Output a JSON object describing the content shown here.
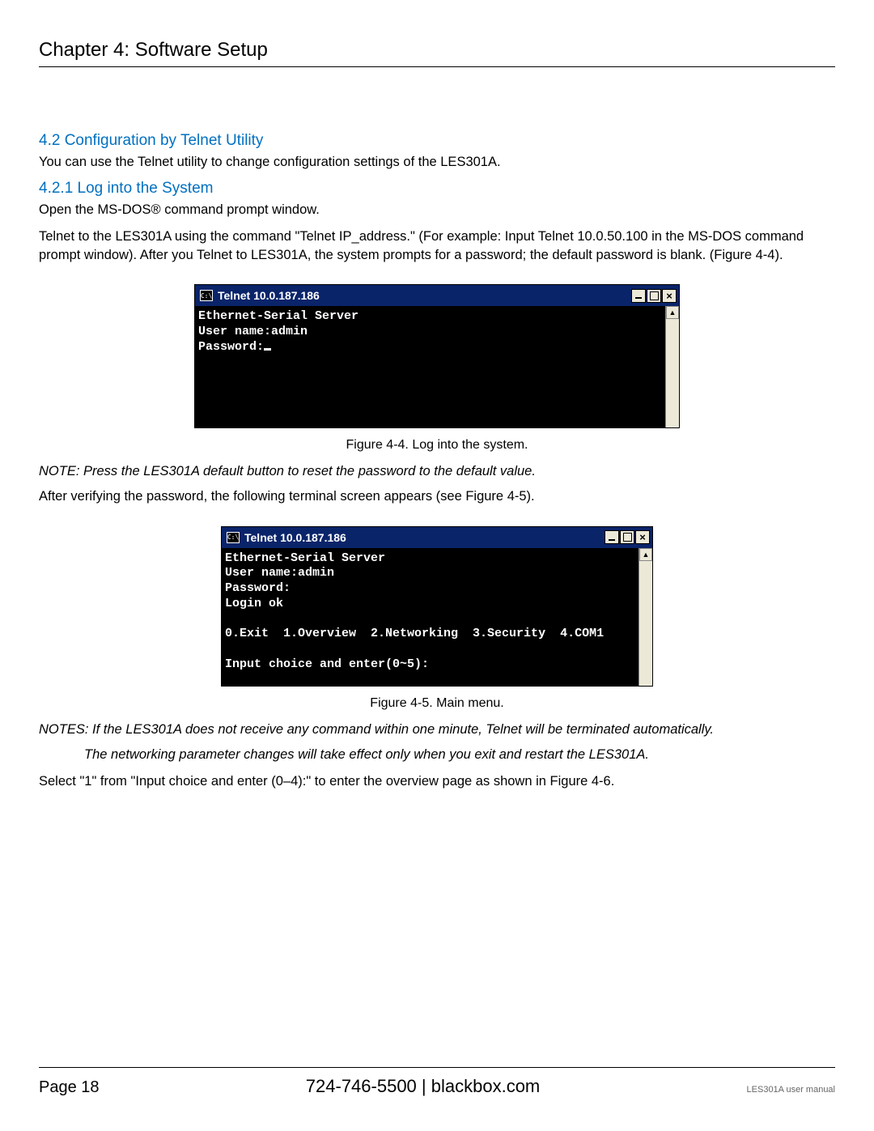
{
  "chapter_title": "Chapter 4: Software Setup",
  "section_4_2": {
    "heading": "4.2 Configuration by Telnet Utility",
    "p1": "You can use the Telnet utility to change configuration settings of the LES301A."
  },
  "section_4_2_1": {
    "heading": "4.2.1 Log into the System",
    "p1": "Open the MS-DOS® command prompt window.",
    "p2": "Telnet to the LES301A using the command \"Telnet IP_address.\" (For example: Input Telnet 10.0.50.100 in the MS-DOS command prompt window). After you Telnet to LES301A, the system prompts for a password; the default password is blank. (Figure 4-4)."
  },
  "fig1": {
    "title_prefix": "C:\\",
    "title": "Telnet 10.0.187.186",
    "content": "Ethernet-Serial Server\nUser name:admin\nPassword:",
    "caption": "Figure 4-4. Log into the system."
  },
  "after_fig1": {
    "note": "NOTE: Press the LES301A default button to reset the password to the default value.",
    "p": "After verifying the password, the following terminal screen appears (see Figure 4-5)."
  },
  "fig2": {
    "title_prefix": "C:\\",
    "title": "Telnet 10.0.187.186",
    "content": "Ethernet-Serial Server\nUser name:admin\nPassword:\nLogin ok\n\n0.Exit  1.Overview  2.Networking  3.Security  4.COM1\n\nInput choice and enter(0~5):",
    "caption": "Figure 4-5. Main menu."
  },
  "after_fig2": {
    "note1": "NOTES: If the LES301A does not receive any command within one minute, Telnet will be terminated automatically.",
    "note2": "The networking parameter changes will take effect only when you exit and restart the LES301A.",
    "p": "Select \"1\" from \"Input choice and enter (0–4):\" to enter the overview page as shown in Figure 4-6."
  },
  "footer": {
    "page": "Page 18",
    "phone": "724-746-5500",
    "sep": "   |   ",
    "site": "blackbox.com",
    "manual": "LES301A user manual"
  }
}
